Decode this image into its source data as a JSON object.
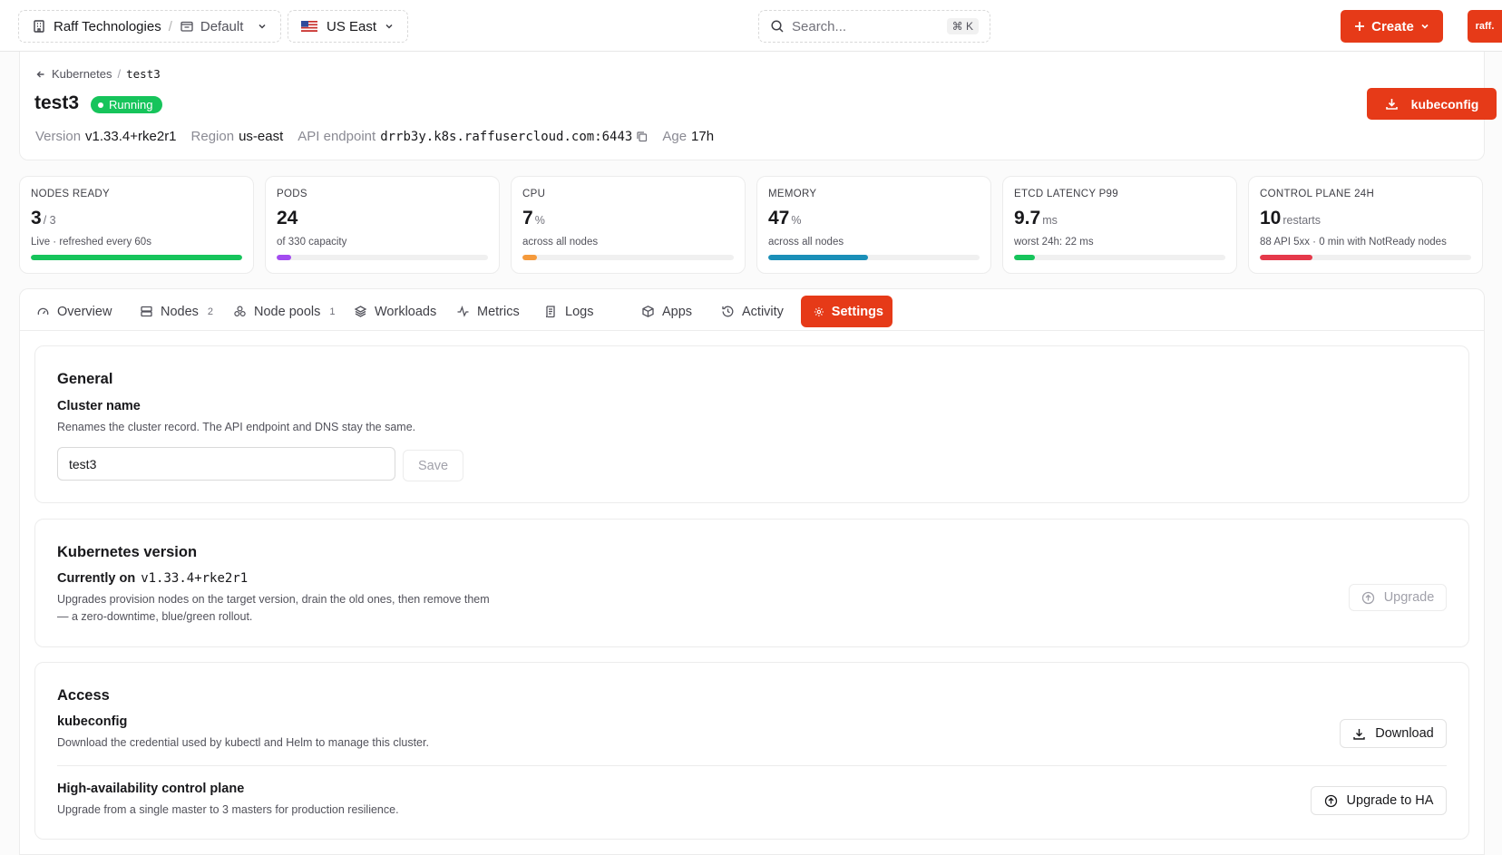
{
  "topbar": {
    "org": "Raff Technologies",
    "project": "Default",
    "region": "US East",
    "search_placeholder": "Search...",
    "search_shortcut": "⌘ K",
    "create_label": "Create",
    "logo_text": "raff."
  },
  "header": {
    "breadcrumb_parent": "Kubernetes",
    "breadcrumb_current": "test3",
    "title": "test3",
    "status": "Running",
    "version_label": "Version",
    "version_value": "v1.33.4+rke2r1",
    "region_label": "Region",
    "region_value": "us-east",
    "api_label": "API endpoint",
    "api_value": "drrb3y.k8s.raffusercloud.com:6443",
    "age_label": "Age",
    "age_value": "17h",
    "kubeconfig_label": "kubeconfig"
  },
  "stats": [
    {
      "label": "NODES READY",
      "value": "3",
      "unit": "/ 3",
      "sub": "Live · refreshed every 60s",
      "progress": 1.0,
      "color": "#16c45b"
    },
    {
      "label": "PODS",
      "value": "24",
      "unit": "",
      "sub": "of 330 capacity",
      "progress": 0.07,
      "color": "#a34cf0"
    },
    {
      "label": "CPU",
      "value": "7",
      "unit": "%",
      "sub": "across all nodes",
      "progress": 0.07,
      "color": "#f59a3c"
    },
    {
      "label": "MEMORY",
      "value": "47",
      "unit": "%",
      "sub": "across all nodes",
      "progress": 0.47,
      "color": "#1a8fb8"
    },
    {
      "label": "ETCD LATENCY P99",
      "value": "9.7",
      "unit": "ms",
      "sub": "worst 24h: 22 ms",
      "progress": 0.1,
      "color": "#16c45b"
    },
    {
      "label": "CONTROL PLANE 24H",
      "value": "10",
      "unit": "restarts",
      "sub": "88 API 5xx · 0 min with NotReady nodes",
      "progress": 0.25,
      "color": "#e5394a"
    }
  ],
  "tabs": [
    {
      "label": "Overview",
      "count": ""
    },
    {
      "label": "Nodes",
      "count": "2"
    },
    {
      "label": "Node pools",
      "count": "1"
    },
    {
      "label": "Workloads",
      "count": ""
    },
    {
      "label": "Metrics",
      "count": ""
    },
    {
      "label": "Logs",
      "count": ""
    },
    {
      "label": "Apps",
      "count": ""
    },
    {
      "label": "Activity",
      "count": ""
    },
    {
      "label": "Settings",
      "count": ""
    }
  ],
  "general": {
    "heading": "General",
    "field_title": "Cluster name",
    "field_desc": "Renames the cluster record. The API endpoint and DNS stay the same.",
    "input_value": "test3",
    "save_label": "Save"
  },
  "k8s_version": {
    "heading": "Kubernetes version",
    "current_prefix": "Currently on",
    "current_value": "v1.33.4+rke2r1",
    "desc_line1": "Upgrades provision nodes on the target version, drain the old ones, then remove them",
    "desc_line2": "— a zero-downtime, blue/green rollout.",
    "upgrade_label": "Upgrade"
  },
  "access": {
    "heading": "Access",
    "kubeconfig_title": "kubeconfig",
    "kubeconfig_desc": "Download the credential used by kubectl and Helm to manage this cluster.",
    "download_label": "Download",
    "ha_title": "High-availability control plane",
    "ha_desc": "Upgrade from a single master to 3 masters for production resilience.",
    "ha_label": "Upgrade to HA"
  },
  "colors": {
    "accent": "#e63a18",
    "running": "#16c45b"
  }
}
